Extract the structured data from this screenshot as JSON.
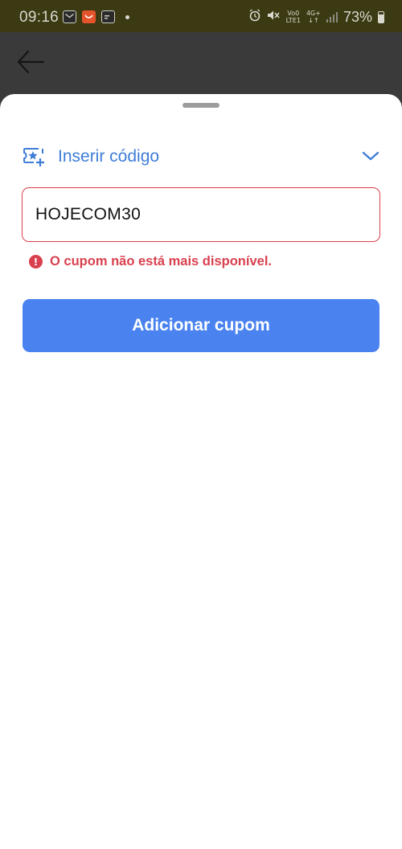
{
  "status_bar": {
    "time": "09:16",
    "network_line1": "Vo0",
    "network_line2": "LTE1",
    "network_line3": "4G+",
    "battery": "73%",
    "notification_icons": [
      "mail-icon",
      "aliexpress-icon",
      "card-icon",
      "dot-icon"
    ],
    "system_icons": [
      "alarm-icon",
      "mute-icon",
      "signal-icon",
      "battery-icon"
    ]
  },
  "header": {
    "back_icon": "arrow-left-icon"
  },
  "sheet": {
    "toggle_label": "Inserir código",
    "toggle_icon": "coupon-star-add-icon",
    "chevron_icon": "chevron-down-icon",
    "input_value": "HOJECOM30",
    "error_icon": "!",
    "error_message": "O cupom não está mais disponível.",
    "submit_label": "Adicionar cupom"
  },
  "colors": {
    "accent_blue": "#3f7dd8",
    "button_blue": "#4a83f0",
    "error_red": "#d9414f",
    "status_bar_bg": "#3b3a12",
    "dim_overlay": "#3a3a3a"
  }
}
